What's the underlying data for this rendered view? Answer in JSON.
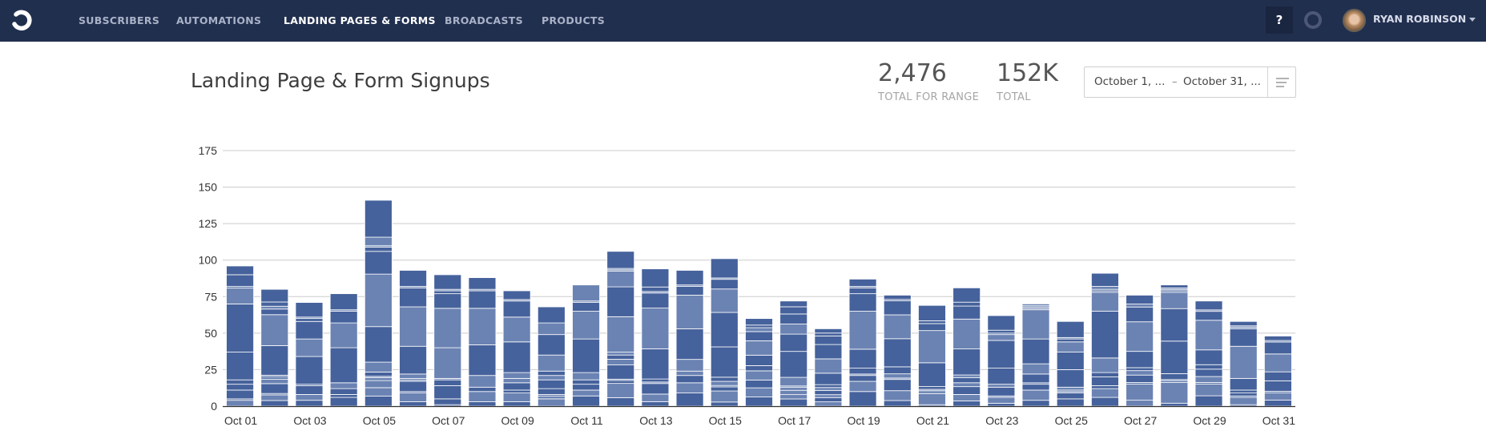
{
  "nav": {
    "items": [
      {
        "label": "SUBSCRIBERS",
        "active": false
      },
      {
        "label": "AUTOMATIONS",
        "active": false
      },
      {
        "label": "LANDING PAGES & FORMS",
        "active": true
      },
      {
        "label": "BROADCASTS",
        "active": false
      },
      {
        "label": "PRODUCTS",
        "active": false
      }
    ],
    "help_label": "?",
    "user_name": "RYAN ROBINSON"
  },
  "header": {
    "title": "Landing Page & Form Signups",
    "stats": [
      {
        "value": "2,476",
        "label": "TOTAL FOR RANGE"
      },
      {
        "value": "152K",
        "label": "TOTAL"
      }
    ],
    "date_range": {
      "start": "October 1, ...",
      "separator": "–",
      "end": "October 31, ..."
    }
  },
  "colors": {
    "nav_bg": "#212f4f",
    "bar_dark": "#46629c",
    "bar_light": "#6b83b3",
    "grid": "#cccccc"
  },
  "chart_data": {
    "type": "bar",
    "stacked": true,
    "title": "",
    "xlabel": "",
    "ylabel": "",
    "ylim": [
      0,
      175
    ],
    "yticks": [
      0,
      25,
      50,
      75,
      100,
      125,
      150,
      175
    ],
    "grid": true,
    "legend": "none",
    "categories": [
      "Oct 01",
      "Oct 02",
      "Oct 03",
      "Oct 04",
      "Oct 05",
      "Oct 06",
      "Oct 07",
      "Oct 08",
      "Oct 09",
      "Oct 10",
      "Oct 11",
      "Oct 12",
      "Oct 13",
      "Oct 14",
      "Oct 15",
      "Oct 16",
      "Oct 17",
      "Oct 18",
      "Oct 19",
      "Oct 20",
      "Oct 21",
      "Oct 22",
      "Oct 23",
      "Oct 24",
      "Oct 25",
      "Oct 26",
      "Oct 27",
      "Oct 28",
      "Oct 29",
      "Oct 30",
      "Oct 31"
    ],
    "xtick_labels": [
      "Oct 01",
      "Oct 03",
      "Oct 05",
      "Oct 07",
      "Oct 09",
      "Oct 11",
      "Oct 13",
      "Oct 15",
      "Oct 17",
      "Oct 19",
      "Oct 21",
      "Oct 23",
      "Oct 25",
      "Oct 27",
      "Oct 29",
      "Oct 31"
    ],
    "totals": [
      96,
      80,
      71,
      77,
      141,
      93,
      90,
      88,
      79,
      68,
      83,
      106,
      94,
      93,
      101,
      60,
      72,
      53,
      87,
      76,
      69,
      81,
      62,
      70,
      58,
      91,
      76,
      83,
      72,
      58,
      48
    ],
    "segments": [
      [
        4,
        1,
        6,
        4,
        3,
        19,
        33,
        11,
        1,
        8,
        6
      ],
      [
        4,
        4,
        1,
        7,
        3,
        2,
        1,
        21,
        22,
        4,
        2,
        3,
        9
      ],
      [
        4,
        4,
        6,
        1,
        19,
        12,
        12,
        2,
        1,
        10
      ],
      [
        6,
        2,
        4,
        4,
        24,
        17,
        8,
        1,
        11
      ],
      [
        7,
        6,
        5,
        2,
        1,
        3,
        7,
        25,
        37,
        16,
        3,
        1,
        6,
        26
      ],
      [
        3,
        6,
        1,
        7,
        1,
        1,
        3,
        19,
        27,
        13,
        1,
        11
      ],
      [
        1,
        4,
        9,
        4,
        1,
        21,
        27,
        10,
        2,
        1,
        10
      ],
      [
        3,
        7,
        3,
        8,
        21,
        25,
        12,
        1,
        8
      ],
      [
        3,
        6,
        2,
        5,
        3,
        4,
        21,
        17,
        11,
        1,
        6
      ],
      [
        5,
        2,
        1,
        4,
        6,
        3,
        3,
        11,
        14,
        8,
        11
      ],
      [
        7,
        4,
        4,
        3,
        5,
        23,
        19,
        6,
        1,
        11
      ],
      [
        6,
        10,
        2,
        1,
        10,
        4,
        3,
        2,
        25,
        21,
        11,
        1,
        1,
        12
      ],
      [
        3,
        5,
        7,
        1,
        2,
        20,
        27,
        10,
        1,
        3,
        12
      ],
      [
        9,
        7,
        5,
        3,
        8,
        21,
        23,
        6,
        1,
        10
      ],
      [
        3,
        8,
        3,
        1,
        3,
        3,
        22,
        25,
        17,
        7,
        1,
        14
      ],
      [
        7,
        7,
        6,
        7,
        4,
        8,
        11,
        7,
        3,
        2,
        5
      ],
      [
        5,
        3,
        3,
        2,
        1,
        6,
        18,
        12,
        7,
        7,
        5,
        4
      ],
      [
        3,
        3,
        2,
        3,
        2,
        2,
        8,
        10,
        10,
        6,
        2,
        3
      ],
      [
        10,
        7,
        4,
        1,
        4,
        13,
        26,
        12,
        4,
        1,
        5
      ],
      [
        4,
        7,
        8,
        1,
        3,
        5,
        20,
        17,
        10,
        1,
        3
      ],
      [
        1,
        8,
        2,
        1,
        2,
        17,
        23,
        5,
        2,
        11
      ],
      [
        4,
        5,
        6,
        3,
        4,
        2,
        20,
        23,
        10,
        3,
        11
      ],
      [
        2,
        4,
        1,
        6,
        2,
        11,
        19,
        4,
        1,
        2,
        10
      ],
      [
        4,
        7,
        4,
        1,
        6,
        7,
        17,
        20,
        1,
        1,
        1,
        1
      ],
      [
        5,
        4,
        1,
        1,
        2,
        12,
        12,
        7,
        2,
        1,
        11
      ],
      [
        6,
        6,
        2,
        6,
        3,
        10,
        32,
        13,
        1,
        1,
        2,
        9
      ],
      [
        4,
        11,
        1,
        5,
        3,
        2,
        11,
        20,
        10,
        2,
        6
      ],
      [
        2,
        14,
        1,
        1,
        4,
        22,
        22,
        11,
        1,
        1,
        1,
        2
      ],
      [
        7,
        8,
        1,
        4,
        5,
        3,
        10,
        20,
        6,
        1,
        6
      ],
      [
        1,
        5,
        1,
        2,
        2,
        8,
        22,
        12,
        1,
        1,
        3
      ],
      [
        4,
        5,
        1,
        7,
        6,
        12,
        8,
        1,
        3
      ]
    ],
    "segment_shades": [
      [
        "light",
        "dark",
        "dark",
        "dark",
        "dark",
        "dark",
        "dark",
        "light",
        "dark",
        "dark",
        "dark"
      ],
      [
        "dark",
        "light",
        "dark",
        "dark",
        "light",
        "light",
        "dark",
        "dark",
        "light",
        "dark",
        "light",
        "dark",
        "dark"
      ],
      [
        "dark",
        "light",
        "dark",
        "dark",
        "dark",
        "light",
        "dark",
        "dark",
        "light",
        "dark"
      ],
      [
        "dark",
        "dark",
        "dark",
        "light",
        "dark",
        "light",
        "dark",
        "light",
        "dark"
      ],
      [
        "dark",
        "light",
        "light",
        "light",
        "light",
        "dark",
        "light",
        "dark",
        "light",
        "dark",
        "dark",
        "light",
        "light",
        "dark"
      ],
      [
        "dark",
        "light",
        "dark",
        "dark",
        "light",
        "dark",
        "light",
        "dark",
        "light",
        "dark",
        "light",
        "dark"
      ],
      [
        "dark",
        "dark",
        "dark",
        "dark",
        "light",
        "light",
        "light",
        "dark",
        "dark",
        "light",
        "dark"
      ],
      [
        "dark",
        "light",
        "dark",
        "light",
        "dark",
        "light",
        "dark",
        "light",
        "dark"
      ],
      [
        "dark",
        "light",
        "dark",
        "dark",
        "light",
        "light",
        "dark",
        "light",
        "dark",
        "light",
        "dark"
      ],
      [
        "light",
        "light",
        "dark",
        "dark",
        "dark",
        "light",
        "dark",
        "light",
        "dark",
        "light",
        "dark"
      ],
      [
        "dark",
        "light",
        "dark",
        "dark",
        "light",
        "dark",
        "light",
        "dark",
        "light",
        "light",
        "dark"
      ],
      [
        "dark",
        "light",
        "dark",
        "light",
        "dark",
        "light",
        "dark",
        "light",
        "light",
        "dark",
        "light",
        "light",
        "light",
        "dark"
      ],
      [
        "dark",
        "light",
        "dark",
        "light",
        "dark",
        "dark",
        "light",
        "dark",
        "light",
        "dark",
        "dark"
      ],
      [
        "dark",
        "light",
        "dark",
        "light",
        "light",
        "dark",
        "light",
        "dark",
        "light",
        "dark"
      ],
      [
        "dark",
        "light",
        "dark",
        "dark",
        "light",
        "dark",
        "dark",
        "dark",
        "light",
        "dark",
        "light",
        "dark"
      ],
      [
        "dark",
        "light",
        "dark",
        "light",
        "dark",
        "dark",
        "light",
        "dark",
        "light",
        "dark",
        "dark"
      ],
      [
        "dark",
        "light",
        "light",
        "light",
        "light",
        "light",
        "dark",
        "dark",
        "light",
        "dark",
        "dark",
        "dark"
      ],
      [
        "light",
        "dark",
        "light",
        "dark",
        "light",
        "dark",
        "dark",
        "light",
        "dark",
        "dark",
        "dark",
        "dark"
      ],
      [
        "dark",
        "light",
        "dark",
        "light",
        "dark",
        "dark",
        "light",
        "dark",
        "dark",
        "light",
        "dark"
      ],
      [
        "dark",
        "light",
        "dark",
        "light",
        "light",
        "dark",
        "dark",
        "light",
        "dark",
        "dark",
        "dark"
      ],
      [
        "dark",
        "light",
        "light",
        "light",
        "dark",
        "dark",
        "light",
        "dark",
        "dark",
        "dark"
      ],
      [
        "dark",
        "light",
        "dark",
        "light",
        "dark",
        "light",
        "dark",
        "light",
        "dark",
        "dark",
        "dark"
      ],
      [
        "dark",
        "light",
        "light",
        "dark",
        "light",
        "dark",
        "dark",
        "light",
        "dark",
        "dark",
        "dark"
      ],
      [
        "dark",
        "light",
        "dark",
        "dark",
        "dark",
        "light",
        "dark",
        "light",
        "light",
        "light",
        "light",
        "dark"
      ],
      [
        "dark",
        "dark",
        "light",
        "dark",
        "light",
        "dark",
        "dark",
        "light",
        "dark",
        "light",
        "dark"
      ],
      [
        "dark",
        "light",
        "dark",
        "dark",
        "dark",
        "light",
        "dark",
        "light",
        "dark",
        "dark",
        "light",
        "dark"
      ],
      [
        "light",
        "light",
        "dark",
        "dark",
        "light",
        "dark",
        "dark",
        "light",
        "dark",
        "light",
        "dark"
      ],
      [
        "dark",
        "light",
        "dark",
        "light",
        "dark",
        "dark",
        "dark",
        "light",
        "dark",
        "light",
        "light",
        "dark"
      ],
      [
        "dark",
        "light",
        "dark",
        "light",
        "dark",
        "dark",
        "dark",
        "light",
        "dark",
        "light",
        "dark"
      ],
      [
        "dark",
        "light",
        "dark",
        "dark",
        "dark",
        "dark",
        "light",
        "dark",
        "light",
        "light",
        "dark"
      ],
      [
        "dark",
        "light",
        "dark",
        "dark",
        "dark",
        "light",
        "dark",
        "light",
        "dark"
      ]
    ]
  }
}
